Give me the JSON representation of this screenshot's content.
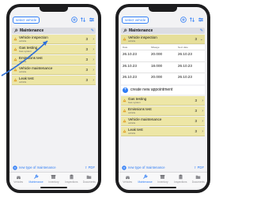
{
  "left": {
    "select_label": "select vehicle",
    "section_title": "Maintenance",
    "rows": [
      {
        "title": "Vehicle inspection",
        "sub": "vehicle",
        "count": "3",
        "chev": "›"
      },
      {
        "title": "Gas testing",
        "sub": "Gas system",
        "count": "3",
        "chev": "›"
      },
      {
        "title": "Emissions test",
        "sub": "vehicle",
        "count": "3",
        "chev": "›"
      },
      {
        "title": "Vehicle maintenance",
        "sub": "vehicle",
        "count": "3",
        "chev": "›"
      },
      {
        "title": "Leak test",
        "sub": "vehicle",
        "count": "3",
        "chev": "›"
      }
    ],
    "new_type_label": "new type of maintenance",
    "pdf_label": "PDF"
  },
  "right": {
    "select_label": "select vehicle",
    "section_title": "Maintenance",
    "selected_row": {
      "title": "Vehicle inspection",
      "sub": "vehicle",
      "count": "3",
      "chev": "›"
    },
    "table_headers": [
      "Date",
      "Mileage",
      "Next date"
    ],
    "table_rows": [
      {
        "date": "26.10.23",
        "mileage": "20.000",
        "next": "26.10.23"
      },
      {
        "date": "26.10.23",
        "mileage": "18.000",
        "next": "26.10.23"
      },
      {
        "date": "26.10.23",
        "mileage": "20.000",
        "next": "26.10.23"
      }
    ],
    "create_label": "create new appointment",
    "rows": [
      {
        "title": "Gas testing",
        "sub": "Gas system",
        "count": "3",
        "chev": "›"
      },
      {
        "title": "Emissions test",
        "sub": "vehicle",
        "count": "3",
        "chev": "›"
      },
      {
        "title": "Vehicle maintenance",
        "sub": "vehicle",
        "count": "3",
        "chev": "›"
      },
      {
        "title": "Leak test",
        "sub": "vehicle",
        "count": "3",
        "chev": "›"
      }
    ],
    "new_type_label": "new type of maintenance",
    "pdf_label": "PDF"
  },
  "tabs": [
    "Vehicles",
    "Maintenance",
    "Inventory",
    "Inspections",
    "Documents"
  ],
  "icons": {
    "toolbar": [
      "add-icon",
      "sort-icon",
      "filter-icon"
    ],
    "section": "wrench-icon",
    "row": "warning-icon",
    "tabs": [
      "car-icon",
      "wrench-icon",
      "box-icon",
      "clipboard-icon",
      "folder-icon"
    ]
  },
  "colors": {
    "accent": "#2f7df6",
    "row_bg": "#ede6a6",
    "phone_frame": "#1d1d1f",
    "arrow": "#2f6fd6"
  }
}
